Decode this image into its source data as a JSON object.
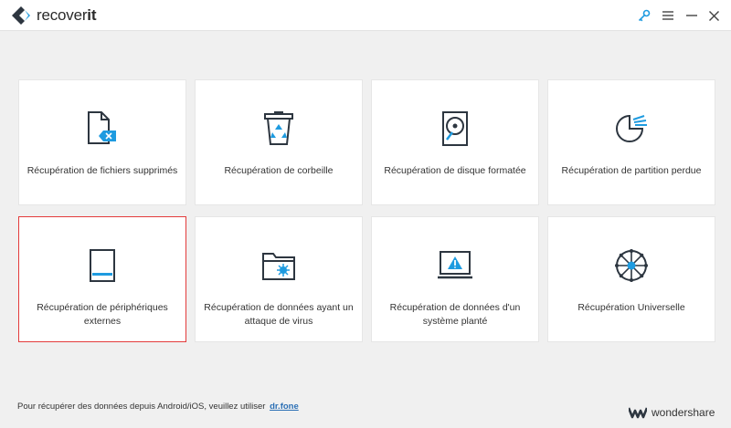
{
  "app": {
    "title_part1": "recover",
    "title_part2": "it"
  },
  "window_controls": {
    "key_icon": "key-icon",
    "menu_icon": "hamburger-menu-icon",
    "minimize_icon": "minimize-icon",
    "close_icon": "close-icon"
  },
  "cards": [
    {
      "label": "Récupération de fichiers supprimés",
      "icon": "deleted-file-icon"
    },
    {
      "label": "Récupération de corbeille",
      "icon": "recycle-bin-icon"
    },
    {
      "label": "Récupération de disque formatée",
      "icon": "hard-disk-icon"
    },
    {
      "label": "Récupération de partition perdue",
      "icon": "partition-icon"
    },
    {
      "label": "Récupération de périphériques externes",
      "icon": "external-device-icon",
      "selected": true
    },
    {
      "label": "Récupération de données ayant un attaque de virus",
      "icon": "virus-folder-icon"
    },
    {
      "label": "Récupération de données d'un système planté",
      "icon": "crashed-system-icon"
    },
    {
      "label": "Récupération Universelle",
      "icon": "universal-icon"
    }
  ],
  "footer": {
    "text": "Pour récupérer des données depuis Android/iOS, veuillez utiliser",
    "link": "dr.fone"
  },
  "brand": {
    "name": "wondershare"
  },
  "colors": {
    "accent": "#1e9be0",
    "icon_dark": "#2d3640",
    "selected_border": "#e33b3b",
    "link": "#2b6fb5"
  }
}
